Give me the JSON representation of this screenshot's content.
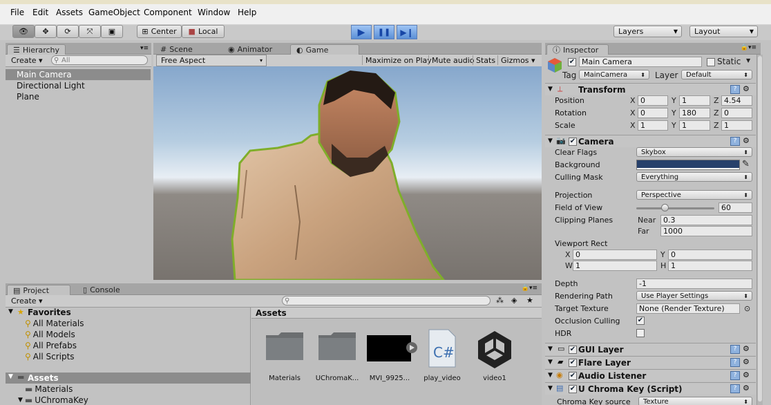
{
  "menu": [
    "File",
    "Edit",
    "Assets",
    "GameObject",
    "Component",
    "Window",
    "Help"
  ],
  "toolbar": {
    "center_label": "Center",
    "local_label": "Local",
    "layers_label": "Layers",
    "layout_label": "Layout"
  },
  "hierarchy": {
    "tab": "Hierarchy",
    "create": "Create",
    "search_placeholder": "All",
    "items": [
      "Main Camera",
      "Directional Light",
      "Plane"
    ]
  },
  "view_tabs": {
    "scene": "Scene",
    "animator": "Animator",
    "game": "Game"
  },
  "game_bar": {
    "aspect": "Free Aspect",
    "maximize": "Maximize on Play",
    "mute": "Mute audio",
    "stats": "Stats",
    "gizmos": "Gizmos"
  },
  "project": {
    "tab": "Project",
    "console_tab": "Console",
    "create": "Create",
    "favorites_label": "Favorites",
    "favorites": [
      "All Materials",
      "All Models",
      "All Prefabs",
      "All Scripts"
    ],
    "assets_root": "Assets",
    "tree_children": [
      "Materials",
      "UChromaKey"
    ],
    "assets_title": "Assets",
    "assets": [
      "Materials",
      "UChromaK...",
      "MVI_9925...",
      "play_video",
      "video1"
    ]
  },
  "inspector": {
    "tab": "Inspector",
    "object_name": "Main Camera",
    "static_label": "Static",
    "tag_label": "Tag",
    "tag_value": "MainCamera",
    "layer_label": "Layer",
    "layer_value": "Default",
    "transform": {
      "title": "Transform",
      "position_label": "Position",
      "rotation_label": "Rotation",
      "scale_label": "Scale",
      "position": [
        "0",
        "1",
        "4.54"
      ],
      "rotation": [
        "0",
        "180",
        "0"
      ],
      "scale": [
        "1",
        "1",
        "1"
      ],
      "axis": [
        "X",
        "Y",
        "Z"
      ]
    },
    "camera": {
      "title": "Camera",
      "clear_flags_label": "Clear Flags",
      "clear_flags": "Skybox",
      "background_label": "Background",
      "background_color": "#27406b",
      "culling_label": "Culling Mask",
      "culling": "Everything",
      "projection_label": "Projection",
      "projection": "Perspective",
      "fov_label": "Field of View",
      "fov": "60",
      "fov_slider_fraction": 0.36,
      "clipping_label": "Clipping Planes",
      "near_label": "Near",
      "near": "0.3",
      "far_label": "Far",
      "far": "1000",
      "viewport_label": "Viewport Rect",
      "vx": "0",
      "vy": "0",
      "vw": "1",
      "vh": "1",
      "vx_label": "X",
      "vy_label": "Y",
      "vw_label": "W",
      "vh_label": "H",
      "depth_label": "Depth",
      "depth": "-1",
      "render_path_label": "Rendering Path",
      "render_path": "Use Player Settings",
      "target_tex_label": "Target Texture",
      "target_tex": "None (Render Texture)",
      "occlusion_label": "Occlusion Culling",
      "hdr_label": "HDR"
    },
    "components": [
      "GUI Layer",
      "Flare Layer",
      "Audio Listener",
      "U Chroma Key (Script)"
    ],
    "chroma_source_label": "Chroma Key source",
    "chroma_source_value": "Texture"
  }
}
